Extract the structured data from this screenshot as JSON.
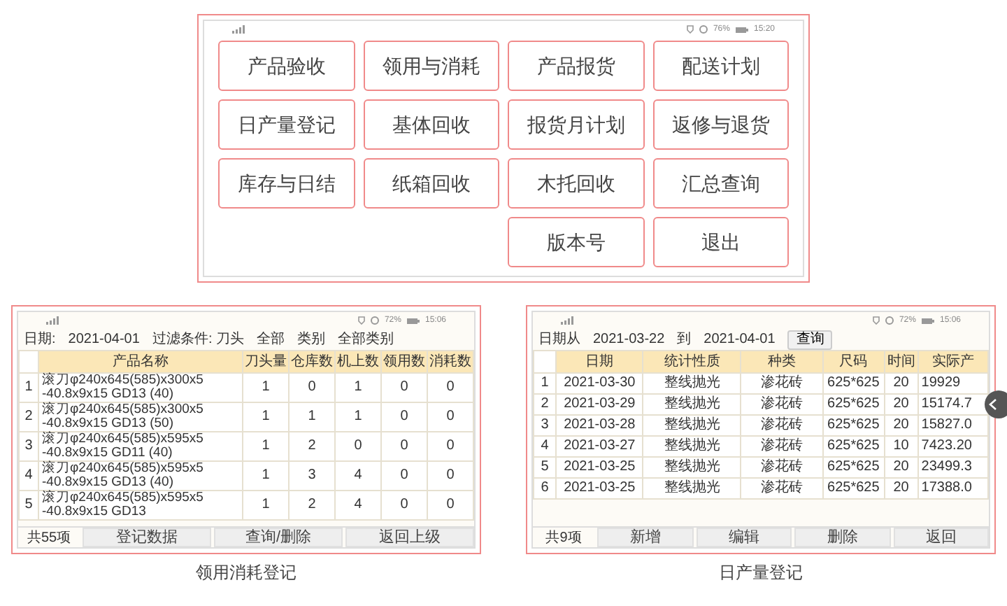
{
  "main_menu": {
    "status_bar": {
      "battery": "76%",
      "time": "15:20"
    },
    "buttons": [
      "产品验收",
      "领用与消耗",
      "产品报货",
      "配送计划",
      "日产量登记",
      "基体回收",
      "报货月计划",
      "返修与退货",
      "库存与日结",
      "纸箱回收",
      "木托回收",
      "汇总查询"
    ],
    "last_row": [
      "版本号",
      "退出"
    ]
  },
  "screens": [
    {
      "kind": "consumption",
      "caption": "领用消耗登记",
      "status_bar": {
        "battery": "72%",
        "time": "15:06"
      },
      "filters": [
        {
          "kind": "field",
          "label": "日期:",
          "value": "2021-04-01"
        },
        {
          "kind": "field",
          "label": "过滤条件: 刀头",
          "value": "全部"
        },
        {
          "kind": "field",
          "label": "类别",
          "value": "全部类别"
        }
      ],
      "table": {
        "columns": [
          "产品名称",
          "刀头量",
          "仓库数",
          "机上数",
          "领用数",
          "消耗数"
        ],
        "rows": [
          {
            "index": "1",
            "cells": [
              "滚刀φ240x645(585)x300x5 -40.8x9x15 GD13 (40)",
              "1",
              "0",
              "1",
              "0",
              "0"
            ]
          },
          {
            "index": "2",
            "cells": [
              "滚刀φ240x645(585)x300x5 -40.8x9x15 GD13 (50)",
              "1",
              "1",
              "1",
              "0",
              "0"
            ]
          },
          {
            "index": "3",
            "cells": [
              "滚刀φ240x645(585)x595x5 -40.8x9x15 GD11 (40)",
              "1",
              "2",
              "0",
              "0",
              "0"
            ]
          },
          {
            "index": "4",
            "cells": [
              "滚刀φ240x645(585)x595x5 -40.8x9x15 GD13 (40)",
              "1",
              "3",
              "4",
              "0",
              "0"
            ]
          },
          {
            "index": "5",
            "cells": [
              "滚刀φ240x645(585)x595x5 -40.8x9x15 GD13",
              "1",
              "2",
              "4",
              "0",
              "0"
            ]
          }
        ]
      },
      "footer": {
        "count": "共55项",
        "buttons": [
          "登记数据",
          "查询/删除",
          "返回上级"
        ]
      }
    },
    {
      "kind": "daily",
      "caption": "日产量登记",
      "status_bar": {
        "battery": "72%",
        "time": "15:06"
      },
      "filters": [
        {
          "kind": "field",
          "label": "日期从",
          "value": "2021-03-22"
        },
        {
          "kind": "field",
          "label": "到",
          "value": "2021-04-01"
        },
        {
          "kind": "button",
          "label": "查询"
        }
      ],
      "floating_handle": true,
      "table": {
        "columns": [
          "日期",
          "统计性质",
          "种类",
          "尺码",
          "时间",
          "实际产"
        ],
        "rows": [
          {
            "index": "1",
            "cells": [
              "2021-03-30",
              "整线抛光",
              "渗花砖",
              "625*625",
              "20",
              "19929"
            ]
          },
          {
            "index": "2",
            "cells": [
              "2021-03-29",
              "整线抛光",
              "渗花砖",
              "625*625",
              "20",
              "15174.7"
            ]
          },
          {
            "index": "3",
            "cells": [
              "2021-03-28",
              "整线抛光",
              "渗花砖",
              "625*625",
              "20",
              "15827.0"
            ]
          },
          {
            "index": "4",
            "cells": [
              "2021-03-27",
              "整线抛光",
              "渗花砖",
              "625*625",
              "10",
              "7423.20"
            ]
          },
          {
            "index": "5",
            "cells": [
              "2021-03-25",
              "整线抛光",
              "渗花砖",
              "625*625",
              "20",
              "23499.3"
            ]
          },
          {
            "index": "6",
            "cells": [
              "2021-03-25",
              "整线抛光",
              "渗花砖",
              "625*625",
              "20",
              "17388.0"
            ]
          }
        ]
      },
      "footer": {
        "count": "共9项",
        "buttons": [
          "新增",
          "编辑",
          "删除",
          "返回"
        ]
      }
    }
  ]
}
